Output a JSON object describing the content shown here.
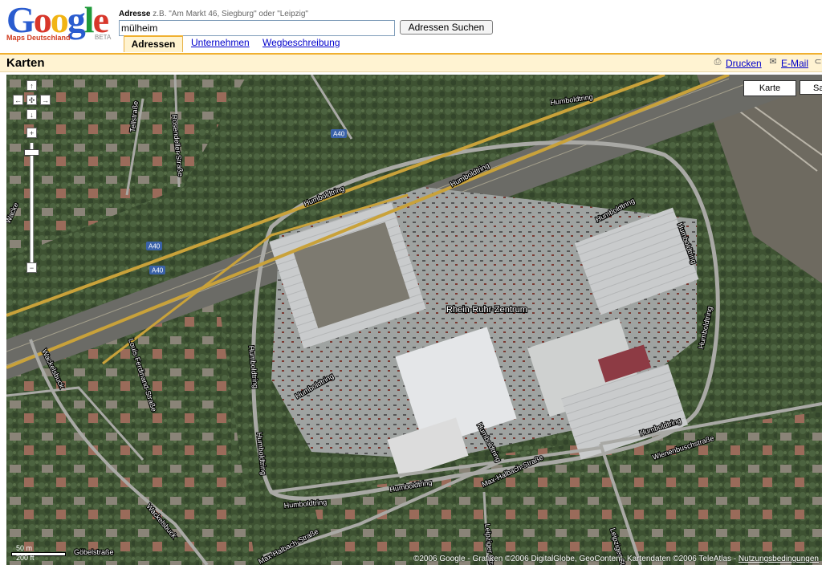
{
  "logo": {
    "name": "Google",
    "subtitle": "Maps Deutschland",
    "beta": "BETA"
  },
  "search": {
    "label": "Adresse",
    "example": "z.B. \"Am Markt 46, Siegburg\" oder \"Leipzig\"",
    "value": "mülheim",
    "button": "Adressen Suchen"
  },
  "tabs": [
    {
      "label": "Adressen"
    },
    {
      "label": "Unternehmen"
    },
    {
      "label": "Wegbeschreibung"
    }
  ],
  "titlebar": {
    "title": "Karten",
    "print": "Drucken",
    "email": "E-Mail"
  },
  "maptypes": [
    "Karte",
    "Sa"
  ],
  "scale": {
    "metric": "50 m",
    "imperial": "200 ft"
  },
  "copyright": {
    "text": "©2006 Google - Grafiken ©2006 DigitalGlobe, GeoContent, Kartendaten ©2006 TeleAtlas - ",
    "terms": "Nutzungsbedingungen"
  },
  "labels": {
    "center": "Rhein-Ruhr-Zentrum",
    "humboldtring": "Humboldtring",
    "a40": "A40",
    "wienenbusch": "Wienenbuschstraße",
    "maxhalbach": "Max-Halbach-Straße",
    "wackelsbuck": "Wackelsbuck",
    "louis": "Louis-Ferdinand-Straße",
    "rosendeller": "Rosendeller Straße",
    "tellstrasse": "Tellstraße",
    "leipziger": "Leipziger Straße",
    "gobelstrasse": "Göbelstraße",
    "wackel_short": "Wacke"
  },
  "colors": {
    "accent": "#f0b030",
    "link": "#0000cc",
    "titlebar_bg": "#fff3d2"
  },
  "icons": {
    "print": "printer-icon",
    "email": "envelope-icon"
  }
}
